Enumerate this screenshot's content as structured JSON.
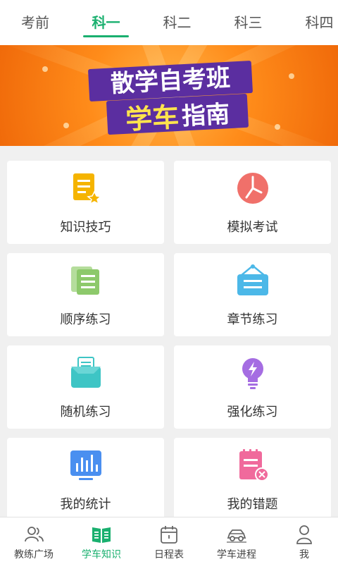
{
  "tabs": [
    {
      "label": "考前"
    },
    {
      "label": "科一",
      "active": true
    },
    {
      "label": "科二"
    },
    {
      "label": "科三"
    },
    {
      "label": "科四"
    }
  ],
  "banner": {
    "line1": "散学自考班",
    "line2_highlight": "学车",
    "line2_rest": "指南"
  },
  "cards": [
    {
      "label": "知识技巧",
      "icon": "knowledge-doc-icon",
      "color": "#f5b400"
    },
    {
      "label": "模拟考试",
      "icon": "clock-icon",
      "color": "#f0706a"
    },
    {
      "label": "顺序练习",
      "icon": "list-pages-icon",
      "color": "#8dc96b"
    },
    {
      "label": "章节练习",
      "icon": "hanging-board-icon",
      "color": "#4cb8e8"
    },
    {
      "label": "随机练习",
      "icon": "document-tray-icon",
      "color": "#3ec5c5"
    },
    {
      "label": "强化练习",
      "icon": "lightbulb-icon",
      "color": "#a56de2"
    },
    {
      "label": "我的统计",
      "icon": "bar-chart-icon",
      "color": "#4a8ff0"
    },
    {
      "label": "我的错题",
      "icon": "wrong-notebook-icon",
      "color": "#f06a9c"
    }
  ],
  "bottom_nav": [
    {
      "label": "教练广场",
      "icon": "people-icon"
    },
    {
      "label": "学车知识",
      "icon": "open-book-icon",
      "active": true
    },
    {
      "label": "日程表",
      "icon": "calendar-icon"
    },
    {
      "label": "学车进程",
      "icon": "car-icon"
    },
    {
      "label": "我",
      "icon": "user-icon"
    }
  ],
  "colors": {
    "accent": "#1ab06f",
    "banner": "#ff8c1a",
    "board": "#5b2ea0"
  }
}
